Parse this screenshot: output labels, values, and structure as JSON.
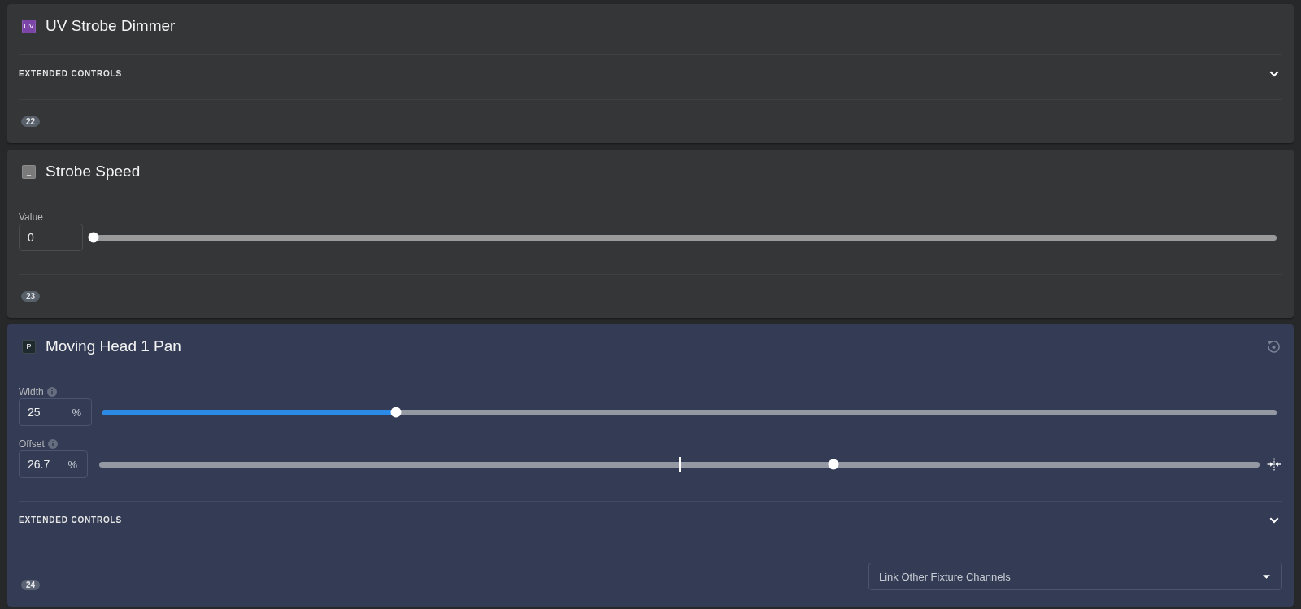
{
  "channels": [
    {
      "icon": {
        "label": "UV",
        "color": "#7b45a8"
      },
      "title": "UV Strobe Dimmer",
      "selected": false,
      "reset_button": false,
      "extended_controls": {
        "label": "EXTENDED CONTROLS",
        "expanded": false
      },
      "badge": "22"
    },
    {
      "icon": {
        "label": "_",
        "color": "#7a7a7a"
      },
      "title": "Strobe Speed",
      "selected": false,
      "reset_button": false,
      "controls": [
        {
          "kind": "plain",
          "label": "Value",
          "info": false,
          "value": "0",
          "level": 0
        }
      ],
      "badge": "23"
    },
    {
      "icon": {
        "label": "P",
        "color": "#1f2a2f"
      },
      "title": "Moving Head 1 Pan",
      "selected": true,
      "reset_button": true,
      "controls": [
        {
          "kind": "fill",
          "label": "Width",
          "info": true,
          "value": "25",
          "unit": "%",
          "level": 0.25
        },
        {
          "kind": "centered",
          "label": "Offset",
          "info": true,
          "value": "26.7",
          "unit": "%",
          "level": 0.633
        }
      ],
      "extended_controls": {
        "label": "EXTENDED CONTROLS",
        "expanded": false
      },
      "badge": "24",
      "link_select": {
        "placeholder": "Link Other Fixture Channels"
      }
    }
  ]
}
